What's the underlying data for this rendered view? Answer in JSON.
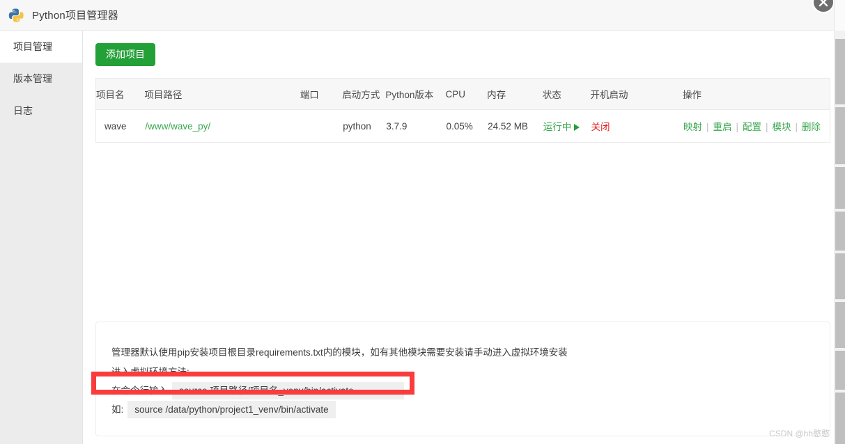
{
  "window": {
    "title": "Python项目管理器",
    "logo_icon": "python-logo-icon",
    "close_icon": "close-icon"
  },
  "sidebar": {
    "items": [
      {
        "label": "项目管理",
        "active": true
      },
      {
        "label": "版本管理",
        "active": false
      },
      {
        "label": "日志",
        "active": false
      }
    ]
  },
  "toolbar": {
    "add_label": "添加项目"
  },
  "table": {
    "columns": [
      "项目名",
      "项目路径",
      "端口",
      "启动方式",
      "Python版本",
      "CPU",
      "内存",
      "状态",
      "开机启动",
      "操作"
    ],
    "rows": [
      {
        "name": "wave",
        "path": "/www/wave_py/",
        "port": "",
        "start_mode": "python",
        "python_version": "3.7.9",
        "cpu": "0.05%",
        "memory": "24.52 MB",
        "status": "运行中",
        "status_icon": "play-triangle-icon",
        "boot": "关闭",
        "operations": [
          "映射",
          "重启",
          "配置",
          "模块",
          "删除"
        ],
        "op_separator": "|"
      }
    ]
  },
  "notes": {
    "line1": "管理器默认使用pip安装项目根目录requirements.txt内的模块，如有其他模块需要安装请手动进入虚拟环境安装",
    "line2": "进入虚拟环境方法:",
    "line3_label": "在命令行输入",
    "line3_code": "source 项目路径/项目名_venv/bin/activate",
    "line4_label": "如:",
    "line4_code": "source /data/python/project1_venv/bin/activate"
  },
  "annotation": {
    "highlight_color": "#fa3c3c"
  },
  "watermark": {
    "text": "CSDN @hh憨憨"
  },
  "colors": {
    "accent_green": "#23a038",
    "link_green": "#3aa84f",
    "danger_red": "#e02020",
    "sidebar_bg": "#ececec",
    "header_bg": "#f7f7f7"
  }
}
